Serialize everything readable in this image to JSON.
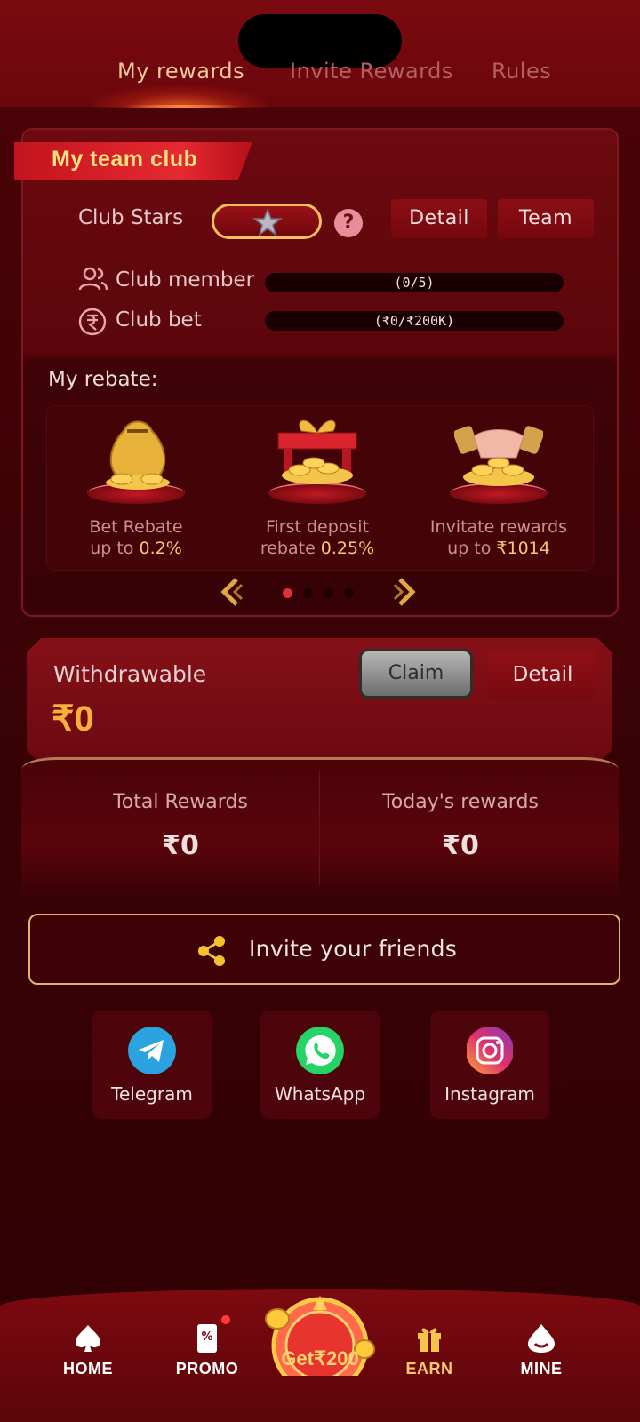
{
  "tabs": [
    {
      "label": "My rewards",
      "active": true
    },
    {
      "label": "Invite Rewards",
      "active": false
    },
    {
      "label": "Rules",
      "active": false
    }
  ],
  "club": {
    "title": "My team club",
    "stars_label": "Club Stars",
    "help": "?",
    "detail_button": "Detail",
    "team_button": "Team",
    "member_label": "Club member",
    "member_progress": "(0/5)",
    "bet_label": "Club bet",
    "bet_progress": "(₹0/₹200K)"
  },
  "rebate": {
    "title": "My rebate:",
    "items": [
      {
        "line1": "Bet Rebate",
        "line2_prefix": "up to ",
        "line2_value": "0.2%",
        "icon": "money-bag-icon"
      },
      {
        "line1": "First deposit",
        "line2_prefix": "rebate ",
        "line2_value": "0.25%",
        "icon": "gift-box-icon"
      },
      {
        "line1": "Invitate rewards",
        "line2_prefix": "up to ",
        "line2_value": "₹1014",
        "icon": "handshake-icon"
      }
    ],
    "page_count": 4,
    "active_page": 1
  },
  "withdraw": {
    "label": "Withdrawable",
    "amount": "₹0",
    "claim_button": "Claim",
    "detail_button": "Detail"
  },
  "totals": {
    "total_label": "Total Rewards",
    "total_value": "₹0",
    "today_label": "Today's rewards",
    "today_value": "₹0"
  },
  "invite": {
    "label": "Invite your friends"
  },
  "share": [
    {
      "label": "Telegram",
      "color": "#2aa3e0"
    },
    {
      "label": "WhatsApp",
      "color": "#25d366"
    },
    {
      "label": "Instagram",
      "color": "#d6249f"
    }
  ],
  "nav": {
    "home": "HOME",
    "promo": "PROMO",
    "get": "Get₹200",
    "earn": "EARN",
    "mine": "MINE"
  },
  "colors": {
    "accent_gold": "#f6c874",
    "brand_red": "#7a0a10"
  }
}
